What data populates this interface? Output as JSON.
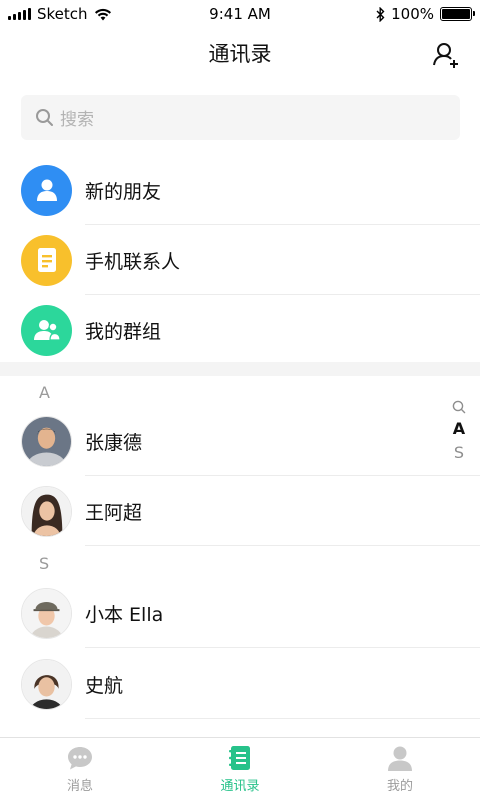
{
  "status_bar": {
    "carrier": "Sketch",
    "time": "9:41 AM",
    "battery": "100%"
  },
  "nav": {
    "title": "通讯录",
    "add_icon": "add-user-icon"
  },
  "search": {
    "placeholder": "搜索"
  },
  "features": [
    {
      "label": "新的朋友",
      "icon": "person-icon",
      "color": "#2f8ef3"
    },
    {
      "label": "手机联系人",
      "icon": "document-icon",
      "color": "#f8c02c"
    },
    {
      "label": "我的群组",
      "icon": "group-icon",
      "color": "#2cd79b"
    }
  ],
  "sections": [
    {
      "letter": "A",
      "contacts": [
        {
          "name": "张康德"
        },
        {
          "name": "王阿超"
        }
      ]
    },
    {
      "letter": "S",
      "contacts": [
        {
          "name": "小本 Ella"
        },
        {
          "name": "史航"
        }
      ]
    }
  ],
  "index_bar": {
    "search_icon": "search-icon",
    "letters": [
      "A",
      "S"
    ],
    "active": "A"
  },
  "tabs": [
    {
      "label": "消息",
      "icon": "chat-bubble-icon",
      "active": false
    },
    {
      "label": "通讯录",
      "icon": "contacts-book-icon",
      "active": true
    },
    {
      "label": "我的",
      "icon": "profile-icon",
      "active": false
    }
  ],
  "colors": {
    "accent": "#27c28a",
    "inactive": "#c8c8c8"
  }
}
